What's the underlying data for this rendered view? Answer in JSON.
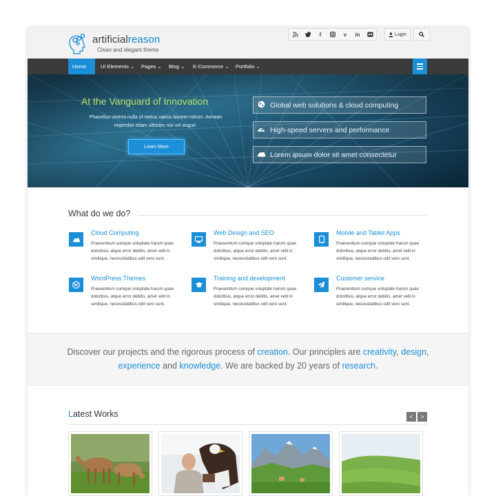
{
  "header": {
    "brand_main": "artificial",
    "brand_accent": "reason",
    "tagline": "Clean and elegant theme",
    "social_icons": [
      "rss-icon",
      "twitter-icon",
      "facebook-icon",
      "instagram-icon",
      "vimeo-icon",
      "linkedin-icon",
      "flickr-icon"
    ],
    "login_label": "Login"
  },
  "nav": {
    "items": [
      {
        "label": "Home ⌄"
      },
      {
        "label": "UI Elements ⌄"
      },
      {
        "label": "Pages ⌄"
      },
      {
        "label": "Blog ⌄"
      },
      {
        "label": "E-Commerce ⌄"
      },
      {
        "label": "Portfolio ⌄"
      }
    ],
    "active_index": 0
  },
  "hero": {
    "title": "At the Vanguard of Innovation",
    "text": "Phasellus viverra nulla ut metus varius laoreet rutrum. Aenean imperdiet etiam ultricies nisi vel augue.",
    "button_label": "Learn More",
    "features": [
      {
        "icon": "globe-icon",
        "label": "Global web solutions & cloud computing"
      },
      {
        "icon": "dashboard-icon",
        "label": "High-speed servers and performance"
      },
      {
        "icon": "cloud-icon",
        "label": "Lorem ipsum dolor sit amet consectetur"
      }
    ]
  },
  "services": {
    "title": "What do we do?",
    "items": [
      {
        "icon": "cloud-icon",
        "title": "Cloud Computing",
        "desc": "Praesentium cumque voluptate harum quae doloribus, atque error debitis, amet velit in similique, necessitatibus odit vero sunt."
      },
      {
        "icon": "monitor-icon",
        "title": "Web Design and SEO",
        "desc": "Praesentium cumque voluptate harum quae doloribus, atque error debitis, amet velit in similique, necessitatibus odit vero sunt."
      },
      {
        "icon": "tablet-icon",
        "title": "Mobile and Tablet Apps",
        "desc": "Praesentium cumque voluptate harum quae doloribus, atque error debitis, amet velit in similique, necessitatibus odit vero sunt."
      },
      {
        "icon": "wordpress-icon",
        "title": "WordPress Themes",
        "desc": "Praesentium cumque voluptate harum quae doloribus, atque error debitis, amet velit in similique, necessitatibus odit vero sunt."
      },
      {
        "icon": "graduation-cap-icon",
        "title": "Training and development",
        "desc": "Praesentium cumque voluptate harum quae doloribus, atque error debitis, amet velit in similique, necessitatibus odit vero sunt."
      },
      {
        "icon": "paper-plane-icon",
        "title": "Customer service",
        "desc": "Praesentium cumque voluptate harum quae doloribus, atque error debitis, amet velit in similique, necessitatibus odit vero sunt."
      }
    ]
  },
  "discover": {
    "t1": "Discover our projects and the rigorous process of ",
    "l1": "creation",
    "t2": ". Our principles are ",
    "l2": "creativity",
    "t3": ", ",
    "l3": "design",
    "t4": ",",
    "l4": "experience",
    "t5": " and ",
    "l5": "knowledge",
    "t6": ". We are backed by 20 years of ",
    "l6": "research",
    "t7": "."
  },
  "latest_works": {
    "title_first": "L",
    "title_rest": "atest Works",
    "prev_label": "<",
    "next_label": ">",
    "thumbnails": [
      "deer-photo",
      "eagle-falconer-photo",
      "mountain-village-photo",
      "green-hills-photo"
    ]
  },
  "colors": {
    "accent": "#1a8ed6",
    "nav_bg": "#3a3a3a",
    "hero_title": "#b9e36a"
  }
}
